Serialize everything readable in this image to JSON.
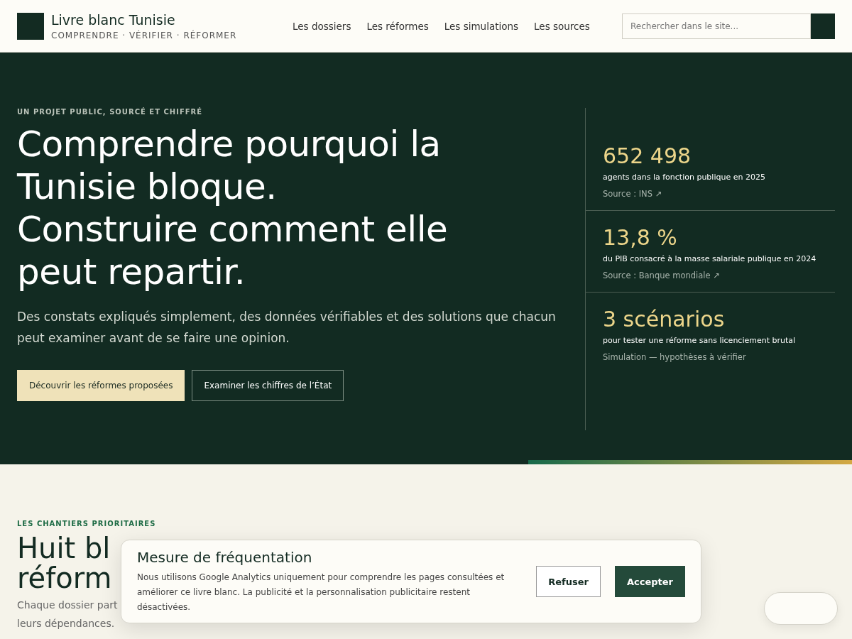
{
  "header": {
    "brand": {
      "title": "Livre blanc Tunisie",
      "tagline": "COMPRENDRE · VÉRIFIER · RÉFORMER"
    },
    "nav": [
      {
        "label": "Les dossiers"
      },
      {
        "label": "Les réformes"
      },
      {
        "label": "Les simulations"
      },
      {
        "label": "Les sources"
      }
    ],
    "search": {
      "placeholder": "Rechercher dans le site..."
    }
  },
  "hero": {
    "eyebrow": "UN PROJET PUBLIC, SOURCÉ ET CHIFFRÉ",
    "title_lines": [
      "Comprendre pourquoi la",
      "Tunisie bloque.",
      "Construire comment elle",
      "peut repartir."
    ],
    "lead": "Des constats expliqués simplement, des données vérifiables et des solutions que chacun peut examiner avant de se faire une opinion.",
    "buttons": [
      {
        "label": "Découvrir les réformes proposées",
        "kind": "primary"
      },
      {
        "label": "Examiner les chiffres de l’État",
        "kind": "outline"
      }
    ],
    "stats": [
      {
        "value": "652 498",
        "caption": "agents dans la fonction publique en 2025",
        "source": "Source : INS ↗"
      },
      {
        "value": "13,8 %",
        "caption": "du PIB consacré à la masse salariale publique en 2024",
        "source": "Source : Banque mondiale ↗"
      },
      {
        "value": "3 scénarios",
        "caption": "pour tester une réforme sans licenciement brutal",
        "source": "Simulation — hypothèses à vérifier"
      }
    ]
  },
  "section": {
    "eyebrow": "LES CHANTIERS PRIORITAIRES",
    "title_lines": [
      "Huit bl",
      "réform"
    ],
    "intro_lines": [
      "Chaque dossier part",
      "leurs dépendances."
    ]
  },
  "cookie_banner": {
    "title": "Mesure de fréquentation",
    "text": "Nous utilisons Google Analytics uniquement pour comprendre les pages consultées et améliorer ce livre blanc. La publicité et la personnalisation publicitaire restent désactivées.",
    "buttons": [
      {
        "label": "Refuser",
        "kind": "outline"
      },
      {
        "label": "Accepter",
        "kind": "primary"
      }
    ]
  }
}
